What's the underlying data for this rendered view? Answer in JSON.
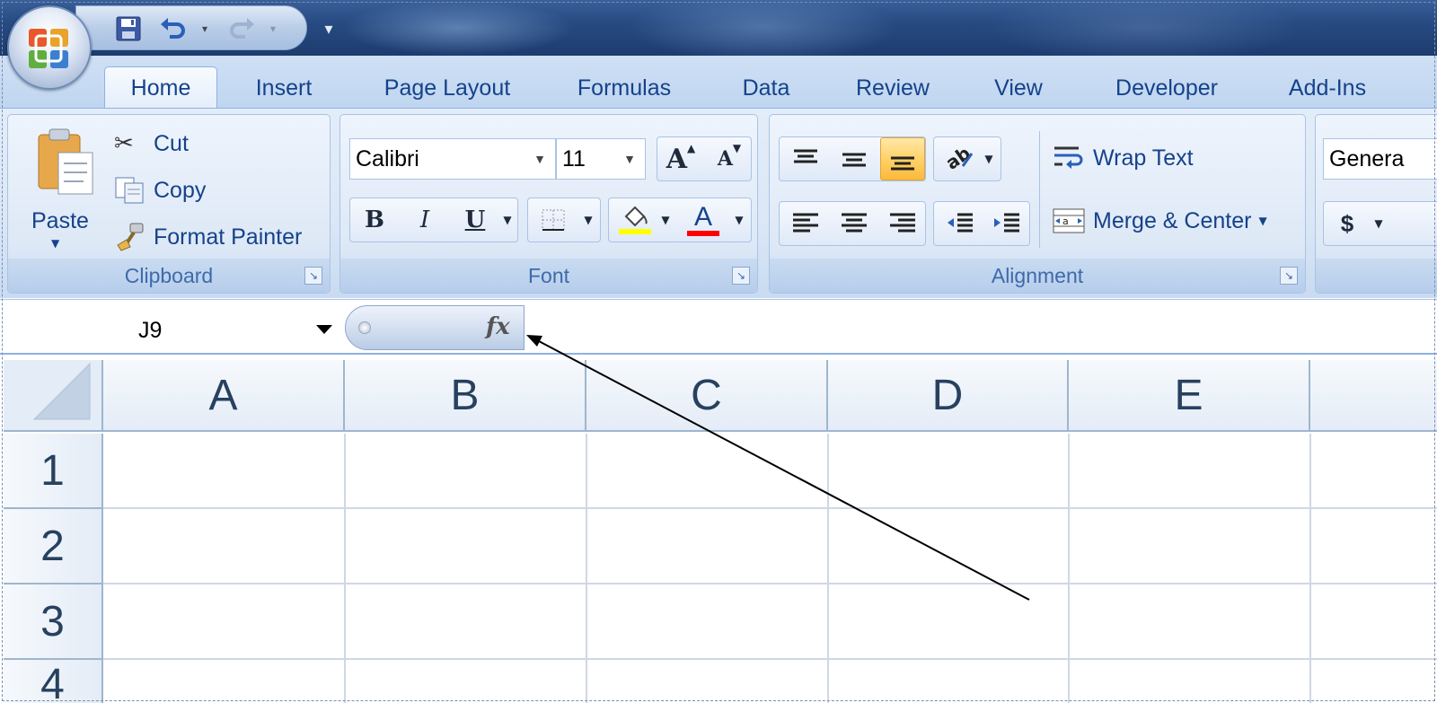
{
  "qat": {
    "save_icon": "save-icon",
    "undo_icon": "undo-icon",
    "redo_icon": "redo-icon",
    "customize_icon": "customize-qat-icon"
  },
  "tabs": [
    {
      "label": "Home",
      "active": true
    },
    {
      "label": "Insert"
    },
    {
      "label": "Page Layout"
    },
    {
      "label": "Formulas"
    },
    {
      "label": "Data"
    },
    {
      "label": "Review"
    },
    {
      "label": "View"
    },
    {
      "label": "Developer"
    },
    {
      "label": "Add-Ins"
    }
  ],
  "clipboard": {
    "paste_label": "Paste",
    "cut_label": "Cut",
    "copy_label": "Copy",
    "format_painter_label": "Format Painter",
    "group_label": "Clipboard"
  },
  "font": {
    "font_name": "Calibri",
    "font_size": "11",
    "bold": "B",
    "italic": "I",
    "underline": "U",
    "grow": "A",
    "shrink": "A",
    "font_color_letter": "A",
    "fill_color": "#ffff00",
    "font_color": "#ff0000",
    "group_label": "Font"
  },
  "alignment": {
    "wrap_text_label": "Wrap Text",
    "merge_center_label": "Merge & Center",
    "group_label": "Alignment"
  },
  "number": {
    "format_value": "Genera",
    "currency": "$"
  },
  "formula_bar": {
    "name_box": "J9",
    "fx": "fx"
  },
  "grid": {
    "columns": [
      "A",
      "B",
      "C",
      "D",
      "E"
    ],
    "rows": [
      "1",
      "2",
      "3",
      "4"
    ]
  },
  "colors": {
    "accent": "#15428b",
    "ribbon_bg": "#dbe7f6",
    "highlight": "#ffd26a"
  }
}
